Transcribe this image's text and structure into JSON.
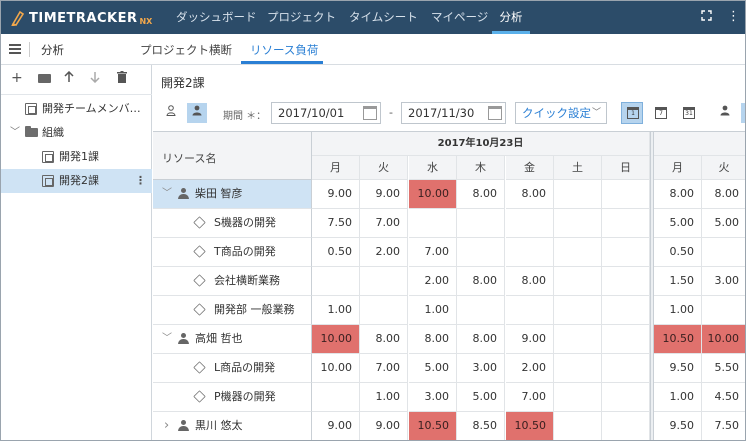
{
  "app": {
    "logo_text": "TIMETRACKER",
    "logo_suffix": "NX"
  },
  "topnav": {
    "items": [
      {
        "label": "ダッシュボード"
      },
      {
        "label": "プロジェクト"
      },
      {
        "label": "タイムシート"
      },
      {
        "label": "マイページ"
      },
      {
        "label": "分析",
        "active": true
      }
    ]
  },
  "subnav": {
    "title": "分析",
    "tabs": [
      {
        "label": "プロジェクト横断"
      },
      {
        "label": "リソース負荷",
        "active": true
      }
    ]
  },
  "tree": {
    "tools": [
      "plus-icon",
      "folder-icon",
      "arrow-up-icon",
      "arrow-down-icon",
      "trash-icon"
    ],
    "items": [
      {
        "label": "開発チームメンバ…",
        "type": "org",
        "level": 0
      },
      {
        "label": "組織",
        "type": "folder",
        "level": 0,
        "expanded": true
      },
      {
        "label": "開発1課",
        "type": "org",
        "level": 1
      },
      {
        "label": "開発2課",
        "type": "org",
        "level": 1,
        "selected": true
      }
    ],
    "more_icon": "⋮"
  },
  "main": {
    "title": "開発2課",
    "period_label": "期間 ＊：",
    "start_date": "2017/10/01",
    "dash": "-",
    "end_date": "2017/11/30",
    "quick_label": "クイック設定",
    "week_header": "2017年10月23日",
    "resource_header": "リソース名",
    "days": [
      "月",
      "火",
      "水",
      "木",
      "金",
      "土",
      "日",
      "月",
      "火"
    ]
  },
  "grid": {
    "rows": [
      {
        "name": "柴田 智彦",
        "kind": "person",
        "expand": "v",
        "selected": true,
        "values": [
          "9.00",
          "9.00",
          "10.00",
          "8.00",
          "8.00",
          "",
          "",
          "8.00",
          "8.00"
        ],
        "hot": [
          2
        ]
      },
      {
        "name": "S機器の開発",
        "kind": "project",
        "values": [
          "7.50",
          "7.00",
          "",
          "",
          "",
          "",
          "",
          "5.00",
          "5.00"
        ],
        "hot": []
      },
      {
        "name": "T商品の開発",
        "kind": "project",
        "values": [
          "0.50",
          "2.00",
          "7.00",
          "",
          "",
          "",
          "",
          "0.50",
          ""
        ],
        "hot": []
      },
      {
        "name": "会社横断業務",
        "kind": "project",
        "values": [
          "",
          "",
          "2.00",
          "8.00",
          "8.00",
          "",
          "",
          "1.50",
          "3.00"
        ],
        "hot": []
      },
      {
        "name": "開発部 一般業務",
        "kind": "project",
        "values": [
          "1.00",
          "",
          "1.00",
          "",
          "",
          "",
          "",
          "1.00",
          ""
        ],
        "hot": []
      },
      {
        "name": "高畑 哲也",
        "kind": "person",
        "expand": "v",
        "values": [
          "10.00",
          "8.00",
          "8.00",
          "8.00",
          "9.00",
          "",
          "",
          "10.50",
          "10.00"
        ],
        "hot": [
          0,
          7,
          8
        ]
      },
      {
        "name": "L商品の開発",
        "kind": "project",
        "values": [
          "10.00",
          "7.00",
          "5.00",
          "3.00",
          "2.00",
          "",
          "",
          "9.50",
          "5.50"
        ],
        "hot": []
      },
      {
        "name": "P機器の開発",
        "kind": "project",
        "values": [
          "",
          "1.00",
          "3.00",
          "5.00",
          "7.00",
          "",
          "",
          "1.00",
          "4.50"
        ],
        "hot": []
      },
      {
        "name": "黒川 悠太",
        "kind": "person",
        "expand": ">",
        "values": [
          "9.00",
          "9.00",
          "10.50",
          "8.50",
          "10.50",
          "",
          "",
          "9.50",
          "7.50"
        ],
        "hot": [
          2,
          4
        ]
      }
    ]
  },
  "colors": {
    "nav_bg": "#2c4c69",
    "accent": "#2a7fd4",
    "overload": "#e0716d",
    "selected": "#cfe3f4"
  }
}
